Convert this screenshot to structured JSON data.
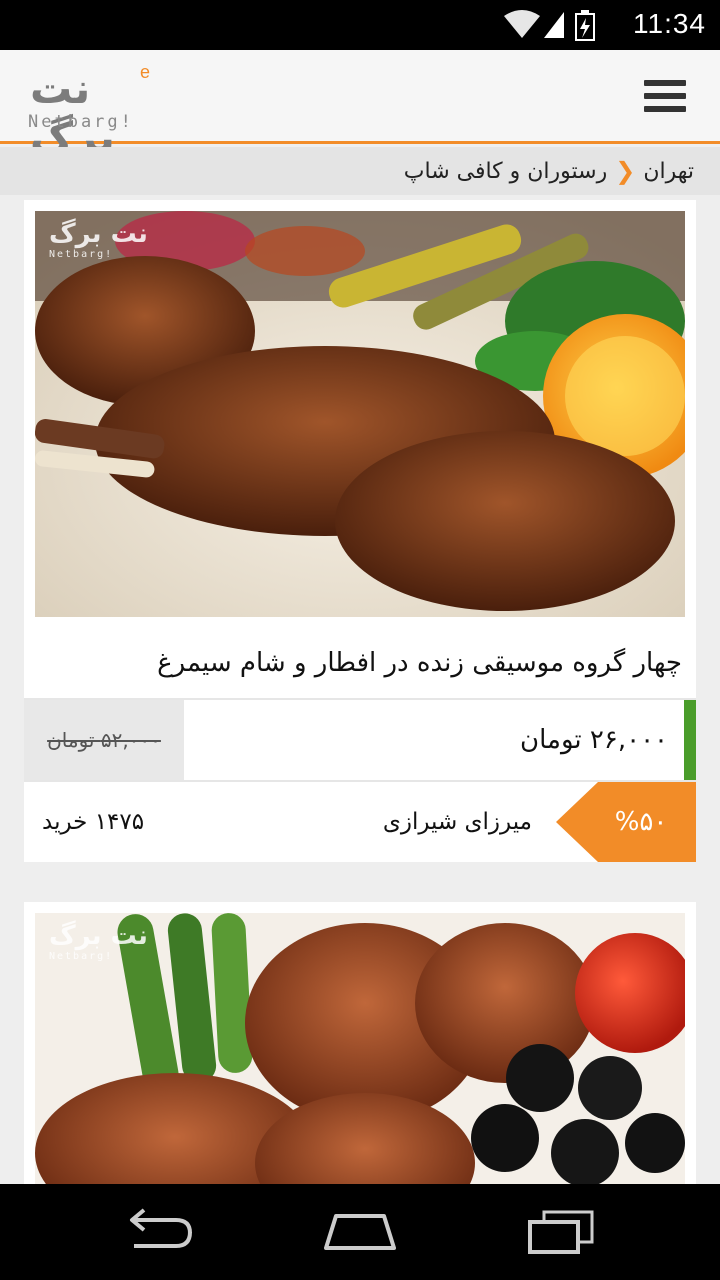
{
  "status_bar": {
    "time": "11:34",
    "icons": [
      "wifi-icon",
      "signal-icon",
      "battery-icon"
    ]
  },
  "header": {
    "logo_text_fa": "نت برگ",
    "logo_letter": "e",
    "logo_text_en": "Netbarg!",
    "menu_icon": "hamburger-menu-icon"
  },
  "breadcrumb": {
    "city": "تهران",
    "separator_icon": "chevron-left-icon",
    "category": "رستوران و کافی شاپ"
  },
  "deals": [
    {
      "watermark_fa": "نت برگ",
      "watermark_en": "Netbarg!",
      "title": "چهار گروه موسیقی زنده در افطار و شام سیمرغ",
      "new_price": "۲۶,۰۰۰ تومان",
      "old_price": "۵۲,۰۰۰ تومان",
      "vendor": "میرزای شیرازی",
      "discount": "%۵۰",
      "buy_count": "۱۴۷۵ خرید"
    },
    {
      "watermark_fa": "نت برگ",
      "watermark_en": "Netbarg!"
    }
  ],
  "colors": {
    "accent": "#f28c28",
    "price_bar": "#4a9d2a",
    "background": "#eeeeee"
  },
  "nav_bar": {
    "buttons": [
      "back-icon",
      "home-icon",
      "recent-apps-icon"
    ]
  }
}
